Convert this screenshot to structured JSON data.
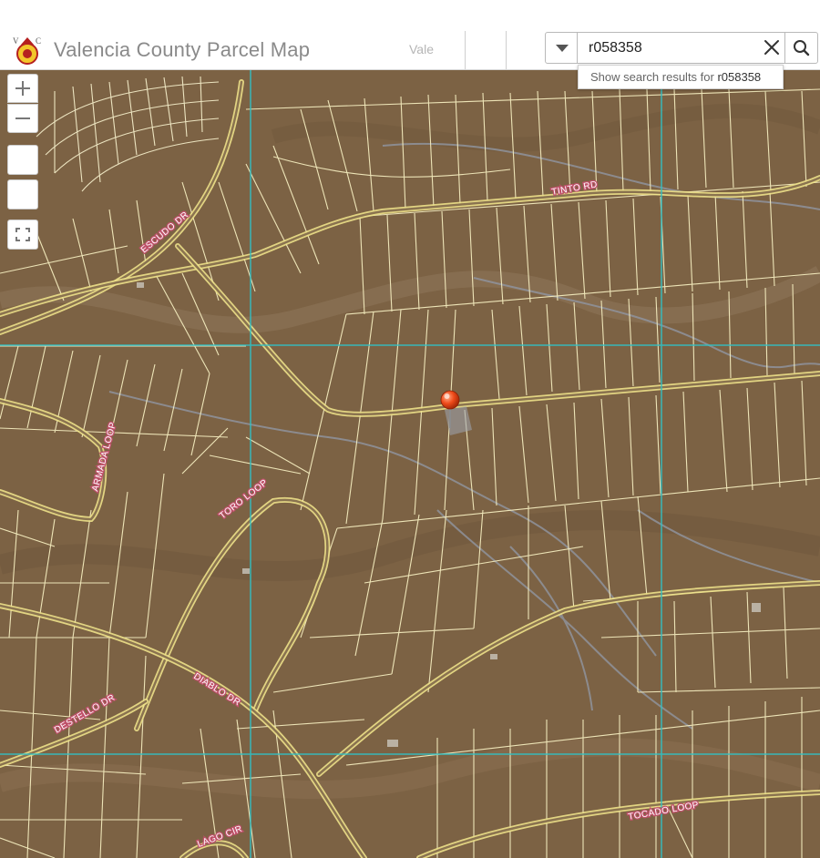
{
  "header": {
    "title": "Valencia County Parcel Map",
    "tab_label": "Vale"
  },
  "search": {
    "value": "r058358",
    "suggestion_prefix": "Show search results for ",
    "suggestion_term": "r058358"
  },
  "map": {
    "road_labels": [
      "TINTO RD",
      "ESCUDO DR",
      "ARMADA LOOP",
      "TORO LOOP",
      "DIABLO DR",
      "DESTELLO DR",
      "LAGO CIR",
      "TOCADO LOOP"
    ],
    "marker_color": "#e8401c",
    "grid_line_color": "#2fc2c6",
    "parcel_line_color": "#f4ecbe",
    "road_color": "#ede18a",
    "terrain_color": "#7c6244"
  },
  "icons": {
    "zoom_in": "plus-icon",
    "zoom_out": "minus-icon",
    "fullscreen": "fullscreen-icon",
    "search": "search-icon",
    "clear": "close-icon",
    "dropdown": "caret-down-icon"
  }
}
